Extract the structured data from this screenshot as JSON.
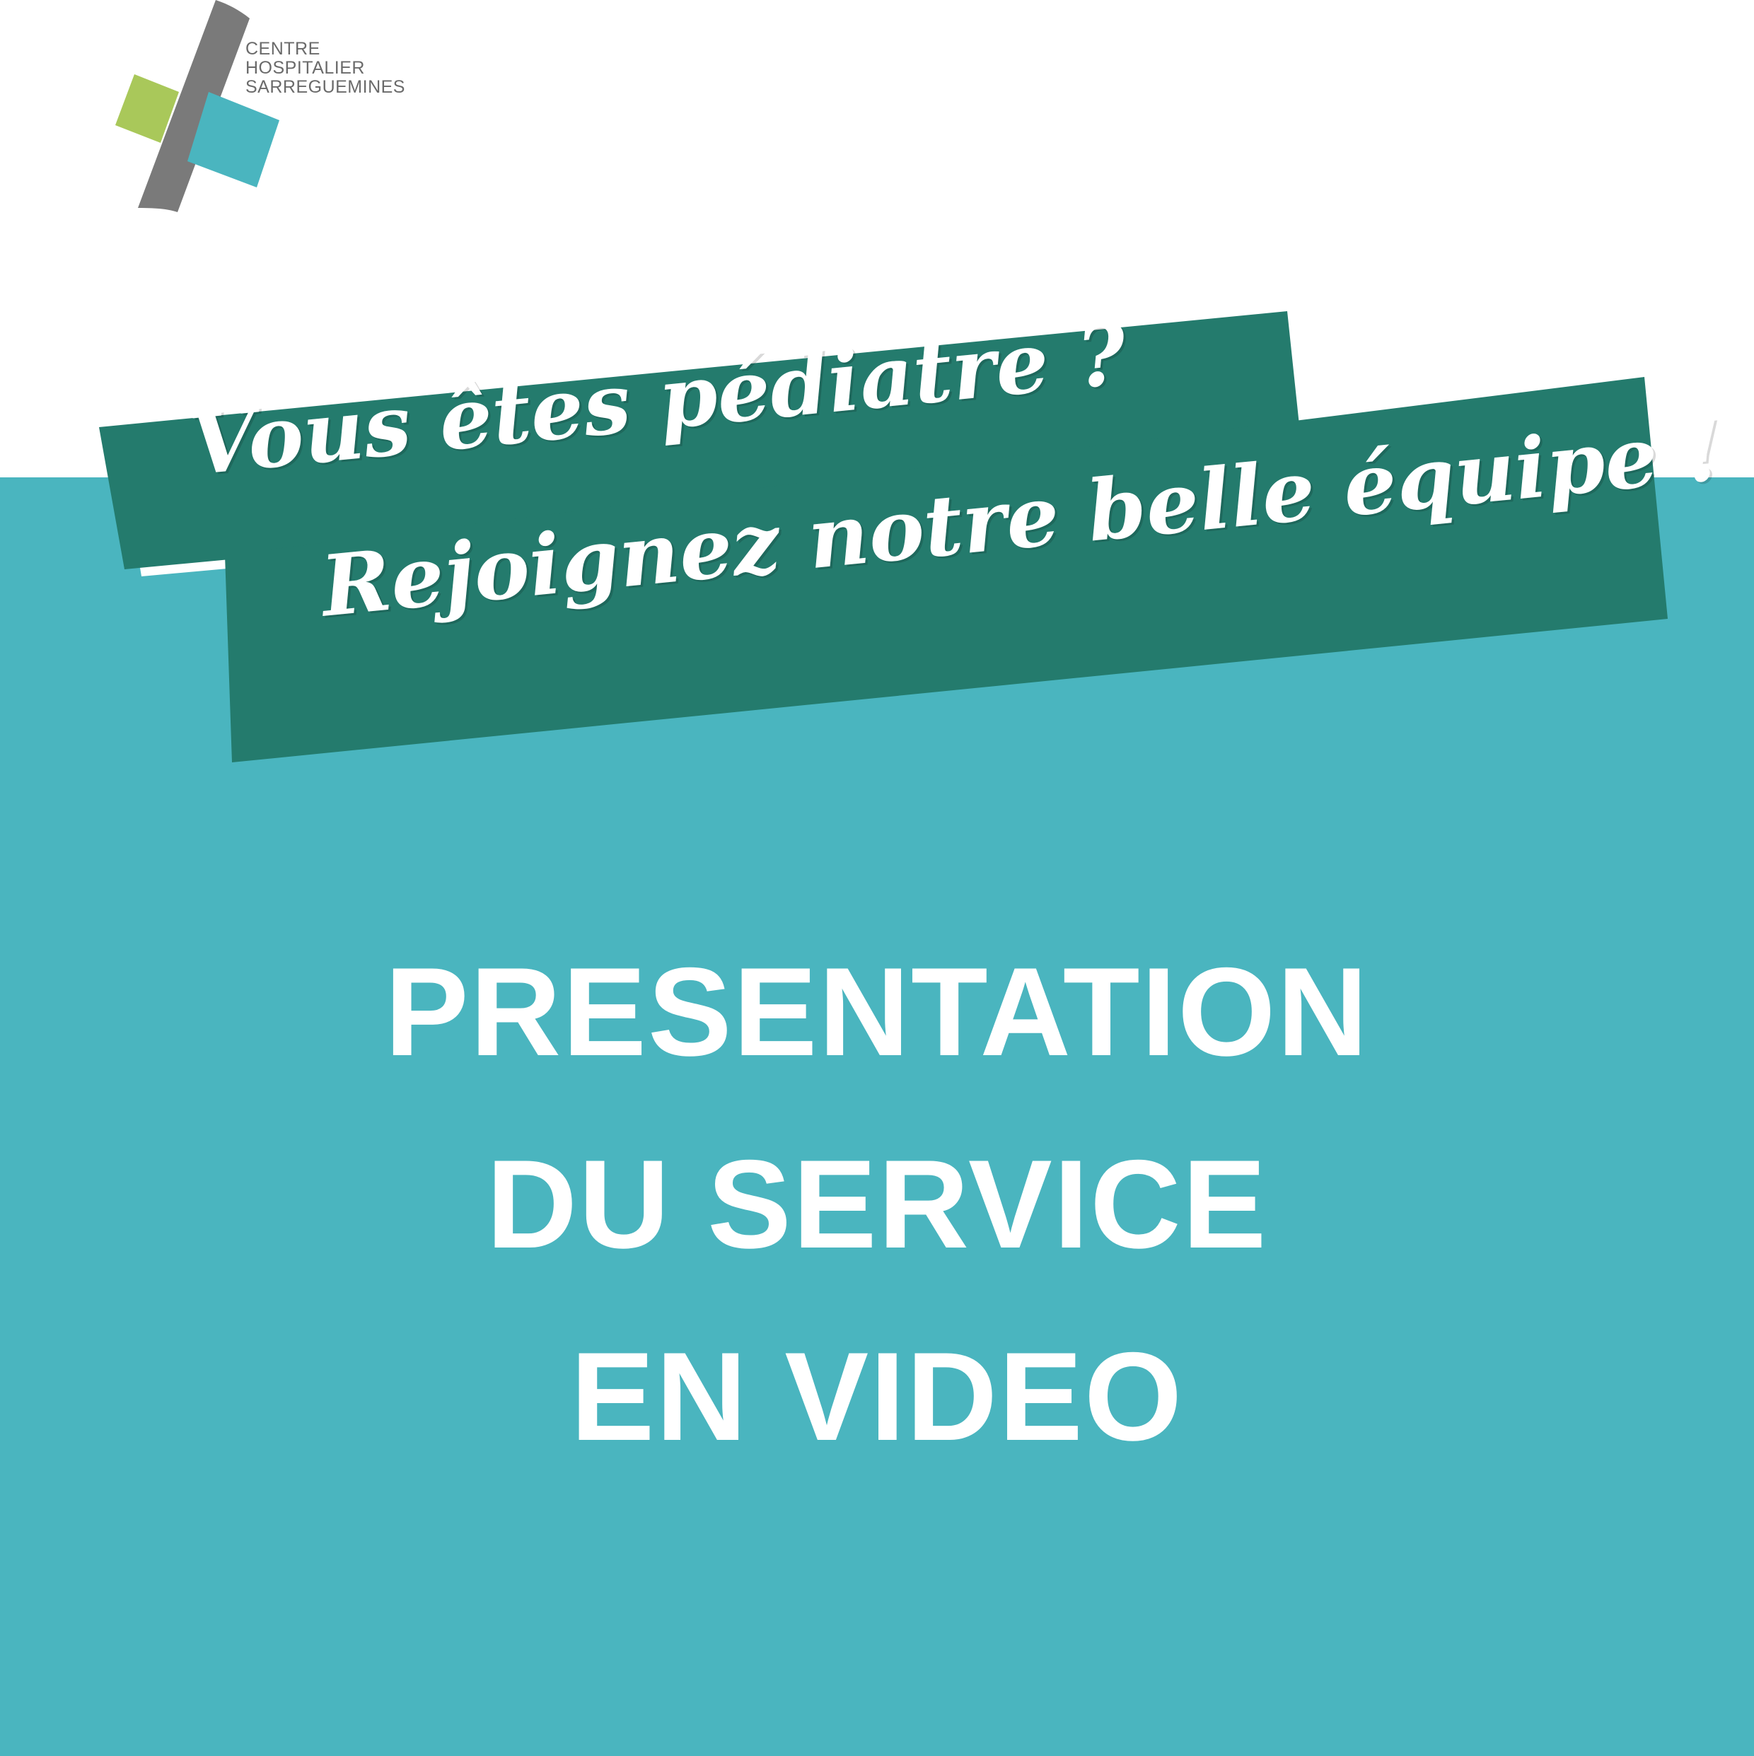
{
  "logo": {
    "lines": [
      "CENTRE",
      "HOSPITALIER",
      "SARREGUEMINES"
    ],
    "colors": {
      "gray": "#7a7a7a",
      "green": "#a9c85a",
      "teal": "#4ab5bf"
    }
  },
  "banner": {
    "line1": "Vous êtes pédiatre ?",
    "line2": "Rejoignez notre belle équipe !",
    "color": "#247b6d"
  },
  "title": {
    "line1": "PRESENTATION",
    "line2": "DU SERVICE",
    "line3": "EN VIDEO"
  },
  "colors": {
    "background": "#ffffff",
    "panel": "#4ab5bf",
    "text": "#ffffff"
  }
}
